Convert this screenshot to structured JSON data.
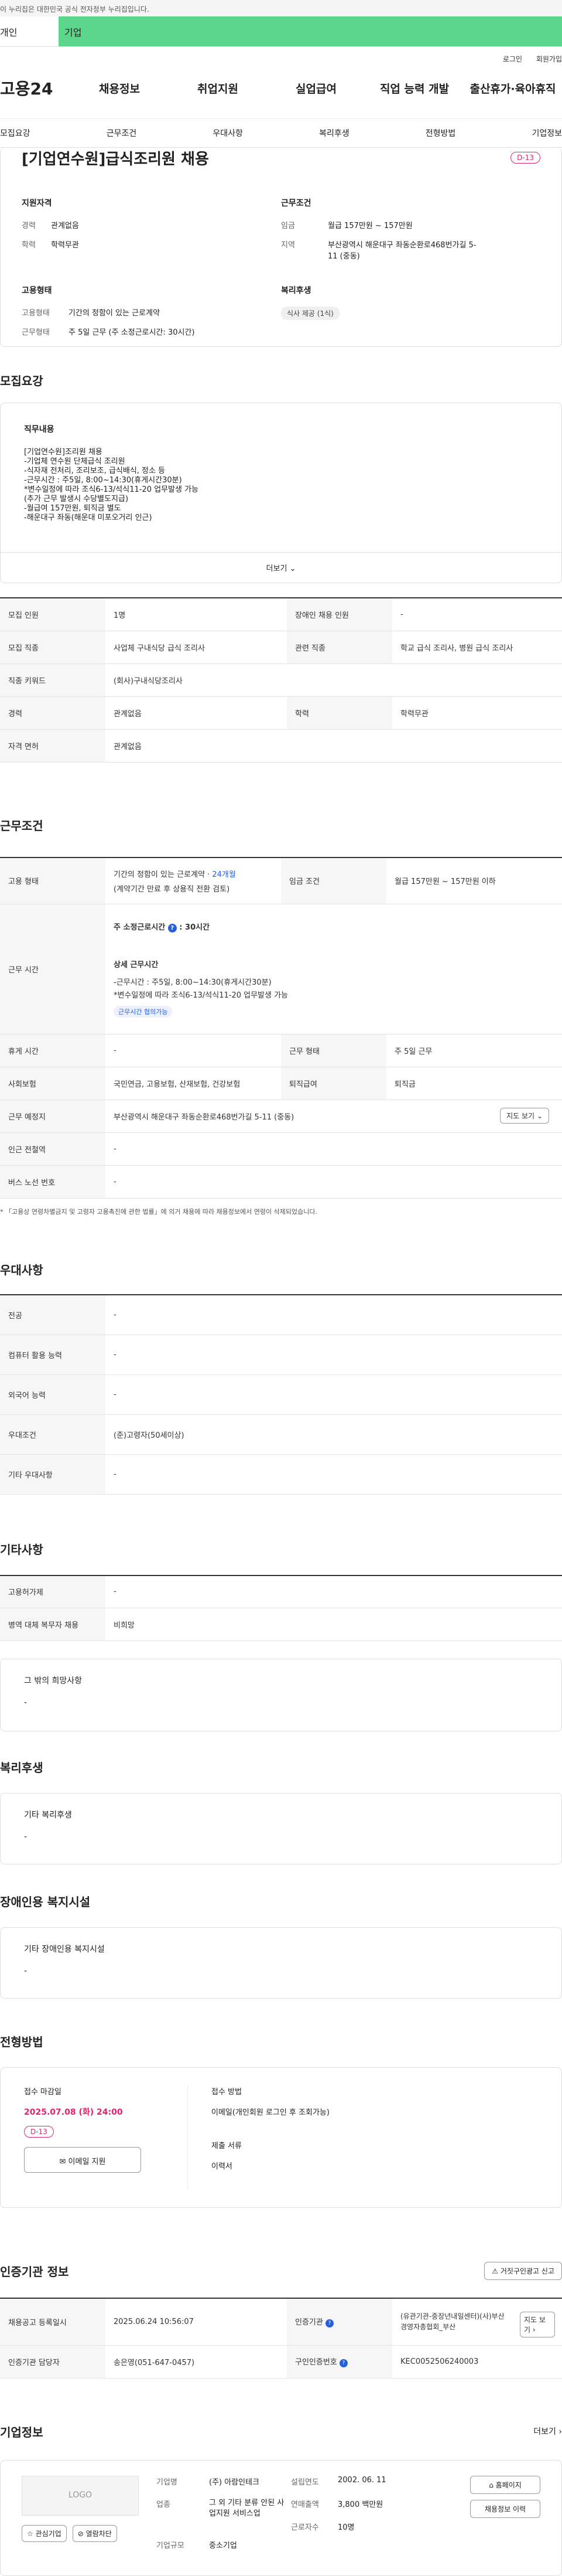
{
  "notice": "이 누리집은 대한민국 공식 전자정부 누리집입니다.",
  "tabs": [
    "개인",
    "기업"
  ],
  "util": [
    "로그인",
    "회원가입"
  ],
  "logo": "고용24",
  "gnb": [
    "채용정보",
    "취업지원",
    "실업급여",
    "직업 능력 개발",
    "출산휴가·육아휴직"
  ],
  "subnav": [
    "모집요강",
    "근무조건",
    "우대사항",
    "복리후생",
    "전형방법",
    "기업정보"
  ],
  "job": {
    "title": "[기업연수원]급식조리원 채용",
    "dday": "D-13",
    "qual_title": "지원자격",
    "cond_title": "근무조건",
    "career_label": "경력",
    "career": "관계없음",
    "edu_label": "학력",
    "edu": "학력무관",
    "pay_label": "임금",
    "pay": "월급 157만원 ~ 157만원",
    "loc_label": "지역",
    "loc": "부산광역시 해운대구 좌동순환로468번가길 5-11 (중동)",
    "emp_title": "고용형태",
    "welfare_title": "복리후생",
    "emptype_label": "고용형태",
    "emptype": "기간의 정함이 있는 근로계약",
    "worktype_label": "근무형태",
    "worktype": "주 5일 근무 (주 소정근로시간: 30시간)",
    "welfare_chip": "식사 제공 (1식)"
  },
  "recruit": {
    "title": "모집요강",
    "duty_label": "직무내용",
    "duty_lines": [
      "[기업연수원]조리원 채용",
      "-기업체 연수원 단체급식 조리원",
      "-식자재 전처리, 조리보조, 급식배식, 정소 등",
      "-근무시간 : 주5일, 8:00~14:30(휴게시간30분)",
      "*변수일정에 따라 조식6-13/석식11-20 업무발생 가능",
      "(추가 근무 발생시 수당별도지급)",
      "-월급여 157만원, 퇴직금 별도",
      "-해운대구 좌동(해운대 미포오거리 인근)"
    ],
    "more": "더보기",
    "rows": [
      {
        "k1": "모집 인원",
        "v1": "1명",
        "k2": "장애인 채용 인원",
        "v2": "-"
      },
      {
        "k1": "모집 직종",
        "v1": "사업체 구내식당 급식 조리사",
        "k2": "관련 직종",
        "v2": "학교 급식 조리사, 병원 급식 조리사"
      },
      {
        "k1": "직종 키워드",
        "v1": "(회사)구내식당조리사",
        "k2": "",
        "v2": ""
      },
      {
        "k1": "경력",
        "v1": "관계없음",
        "k2": "학력",
        "v2": "학력무관"
      },
      {
        "k1": "자격 면허",
        "v1": "관계없음",
        "k2": "",
        "v2": ""
      }
    ]
  },
  "work": {
    "title": "근무조건",
    "emp_label": "고용 형태",
    "emp_value": "기간의 정함이 있는 근로계약 · ",
    "emp_link": "24개월",
    "emp_sub": "(계약기간 만료 후 상용직 전환 검토)",
    "pay_label": "임금 조건",
    "pay_value": "월급 157만원 ~ 157만원 이하",
    "hours_label": "근무 시간",
    "hours_title": "주 소정근로시간",
    "hours_value": "30시간",
    "detail_title": "상세 근무시간",
    "detail_lines": [
      "-근무시간 : 주5일, 8:00~14:30(휴게시간30분)",
      "*변수일정에 따라 조식6-13/석식11-20 업무발생 가능"
    ],
    "detail_chip": "근무시간 협의가능",
    "rows": [
      {
        "k1": "휴게 시간",
        "v1": "-",
        "k2": "근무 형태",
        "v2": "주 5일 근무"
      },
      {
        "k1": "사회보험",
        "v1": "국민연금, 고용보험, 산재보험, 건강보험",
        "k2": "퇴직급여",
        "v2": "퇴직금"
      }
    ],
    "place_label": "근무 예정지",
    "place_value": "부산광역시 해운대구 좌동순환로468번가길 5-11 (중동)",
    "map_button": "지도 보기",
    "subway_label": "인근 전철역",
    "subway_value": "-",
    "bus_label": "버스 노선 번호",
    "bus_value": "-",
    "footnote": "* 「고용상 연령차별금지 및 고령자 고용촉진에 관한 법률」에 의거 채용에 따라 채용정보에서 연령이 삭제되었습니다."
  },
  "pref": {
    "title": "우대사항",
    "rows": [
      {
        "k": "전공",
        "v": "-"
      },
      {
        "k": "컴퓨터 활용 능력",
        "v": "-"
      },
      {
        "k": "외국어 능력",
        "v": "-"
      },
      {
        "k": "우대조건",
        "v": "(준)고령자(50세이상)"
      },
      {
        "k": "기타 우대사항",
        "v": "-"
      }
    ]
  },
  "etc": {
    "title": "기타사항",
    "rows": [
      {
        "k": "고용허가제",
        "v": "-"
      },
      {
        "k": "병역 대체 복무자 채용",
        "v": "비희망"
      }
    ],
    "hope_title": "그 밖의 희망사항",
    "hope_value": "-"
  },
  "benefit": {
    "title": "복리후생",
    "box_title": "기타 복리후생",
    "box_value": "-"
  },
  "disabled": {
    "title": "장애인용 복지시설",
    "box_title": "기타 장애인용 복지시설",
    "box_value": "-"
  },
  "screen": {
    "title": "전형방법",
    "deadline_label": "접수 마감일",
    "deadline": "2025.07.08 (화) 24:00",
    "dday": "D-13",
    "email_btn": "이메일 지원",
    "method_label": "접수 방법",
    "method": "이메일(개인회원 로그인 후 조회가능)",
    "docs_label": "제출 서류",
    "docs": "이력서"
  },
  "agency": {
    "title": "인증기관 정보",
    "report_btn": "거짓구인광고 신고",
    "reg_label": "채용공고 등록일시",
    "reg_value": "2025.06.24 10:56:07",
    "org_label": "인증기관",
    "org_value": "(유관기관-중장년내일센터)(사)부산경영자총협회_부산",
    "map_btn": "지도 보기",
    "mgr_label": "인증기관 담당자",
    "mgr_value": "송은영(051-647-0457)",
    "offer_label": "구인인증번호",
    "offer_value": "KEC0052506240003"
  },
  "company": {
    "title": "기업정보",
    "more": "더보기",
    "logo": "LOGO",
    "interest_btn": "관심기업",
    "block_btn": "열람차단",
    "name_label": "기업명",
    "name": "(주) 아람인테크",
    "founded_label": "설립연도",
    "founded": "2002. 06. 11",
    "industry_label": "업종",
    "industry": "그 외 기타 분류 안된 사업지원 서비스업",
    "revenue_label": "연매출액",
    "revenue": "3,800 백만원",
    "staff_label": "근로자수",
    "staff": "10명",
    "size_label": "기업규모",
    "size": "중소기업",
    "home_btn": "홈페이지",
    "list_btn": "채용정보 이력"
  }
}
